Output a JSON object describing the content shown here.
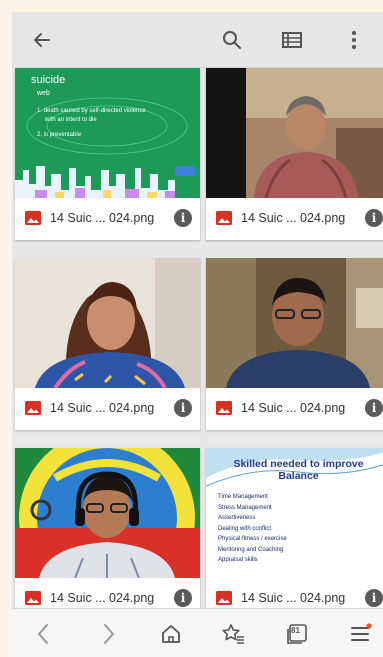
{
  "colors": {
    "appbar": "#e6e6e6",
    "page_background": "#fdf4e9",
    "image_icon": "#d93025",
    "accent_dot": "#f4511e"
  },
  "appbar": {
    "back_icon": "arrow-left-icon",
    "search_icon": "search-icon",
    "view_icon": "list-view-icon",
    "menu_icon": "more-vert-icon"
  },
  "slide": {
    "heading": "suicide",
    "sub": "web",
    "line1": "1. death caused by self-directed violence",
    "line2": "with an intent to die",
    "line3": "2. is preventable"
  },
  "skills": {
    "title": "Skilled needed to improve Balance",
    "items": [
      "Time Management",
      "Stress Management",
      "Assertiveness",
      "Dealing with conflict",
      "Physical fitness / exercise",
      "Mentoring and Coaching",
      "Appraisal skills"
    ]
  },
  "files": [
    {
      "name": "14 Suic ... 024.png"
    },
    {
      "name": "14 Suic ... 024.png"
    },
    {
      "name": "14 Suic ... 024.png"
    },
    {
      "name": "14 Suic ... 024.png"
    },
    {
      "name": "14 Suic ... 024.png"
    },
    {
      "name": "14 Suic ... 024.png"
    }
  ],
  "navbar": {
    "back": "chevron-left-icon",
    "forward": "chevron-right-icon",
    "home": "home-icon",
    "bookmarks": "star-list-icon",
    "tabs_count": "81",
    "menu": "hamburger-menu-icon"
  }
}
